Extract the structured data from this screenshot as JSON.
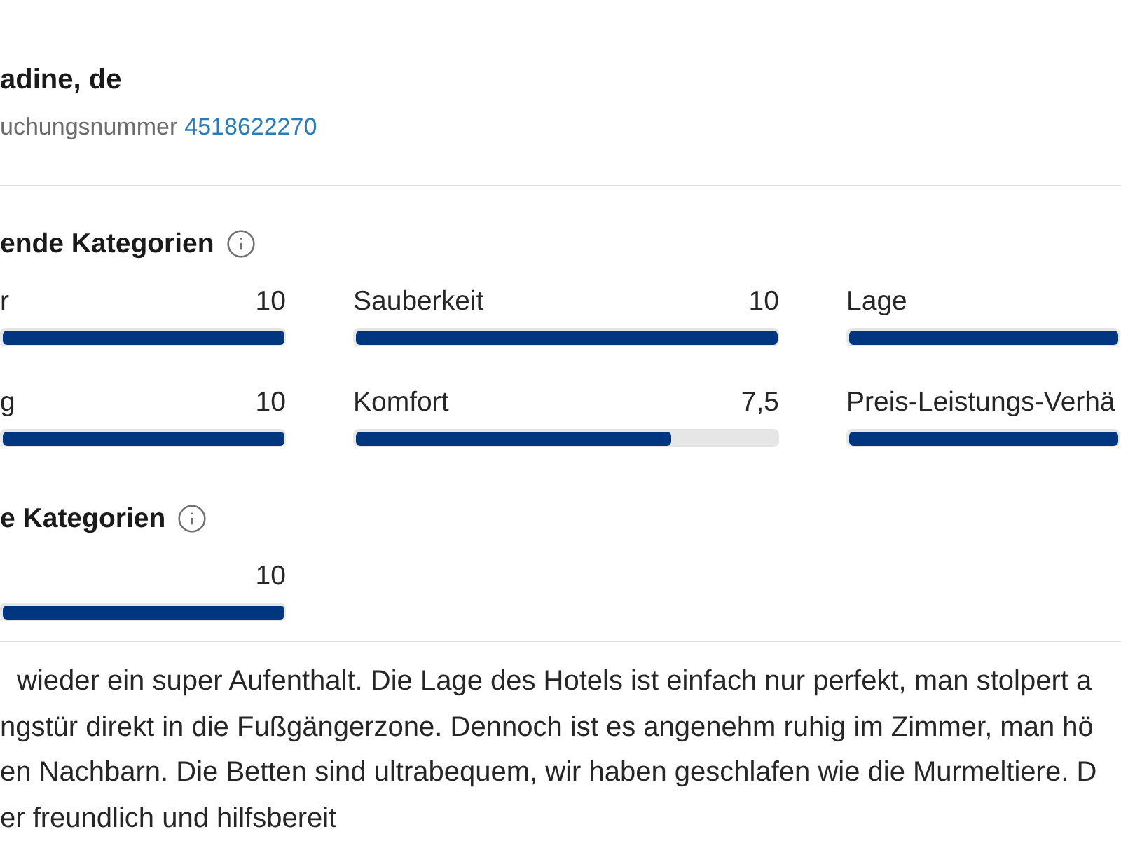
{
  "header": {
    "title": "adine, de",
    "booking_label": "uchungsnummer",
    "booking_number": "4518622270"
  },
  "sections": [
    {
      "title": "ende Kategorien",
      "categories": [
        {
          "label": "r",
          "value": "10",
          "level": 1
        },
        {
          "label": "Sauberkeit",
          "value": "10",
          "level": 1
        },
        {
          "label": "Lage",
          "level": 1
        },
        {
          "label": "g",
          "value": "10",
          "level": 1
        },
        {
          "label": "Komfort",
          "value": "7,5",
          "level": 0.75
        },
        {
          "label": "Preis-Leistungs-Verhä",
          "level": 1
        }
      ]
    },
    {
      "title": "e Kategorien",
      "categories": [
        {
          "value": "10",
          "level": 1
        }
      ]
    }
  ],
  "review": {
    "lines": [
      "wieder ein super Aufenthalt. Die Lage des Hotels ist einfach nur perfekt, man stolpert a",
      "ngstür direkt in die Fußgängerzone. Dennoch ist es angenehm ruhig im Zimmer, man hö",
      "en Nachbarn. Die Betten sind ultrabequem, wir haben geschlafen wie die Murmeltiere. D",
      "er freundlich und hilfsbereit"
    ]
  }
}
